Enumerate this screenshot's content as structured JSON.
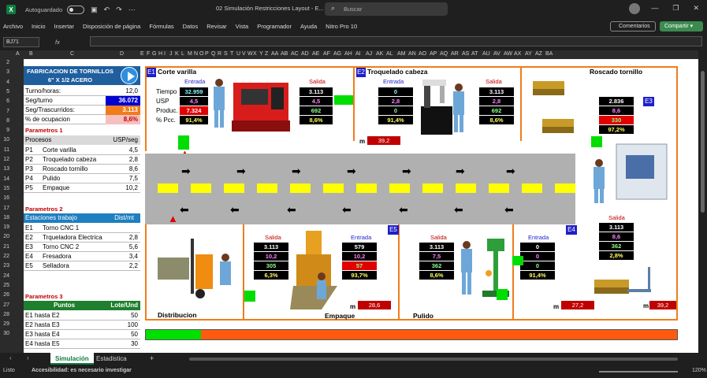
{
  "titlebar": {
    "autosave_label": "Autoguardado",
    "doc_title": "02 Simulación Restricciones Layout  -  E...",
    "search_placeholder": "Buscar"
  },
  "menu": [
    "Archivo",
    "Inicio",
    "Insertar",
    "Disposición de página",
    "Fórmulas",
    "Datos",
    "Revisar",
    "Vista",
    "Programador",
    "Ayuda",
    "Nitro Pro 10"
  ],
  "buttons": {
    "comments": "Comentarios",
    "share": "Compartir"
  },
  "formula": {
    "namebox": "BJ71",
    "fx": "fx"
  },
  "columns": [
    "A",
    "B",
    "C",
    "D",
    "E",
    "F",
    "G",
    "H",
    "I",
    "J",
    "K",
    "L",
    "M",
    "N",
    "O",
    "P",
    "Q",
    "R",
    "S",
    "T",
    "U",
    "V",
    "W",
    "X",
    "Y",
    "Z",
    "AA",
    "AB",
    "AC",
    "AD",
    "AE",
    "AF",
    "AG",
    "AH",
    "AI",
    "AJ",
    "AK",
    "AL",
    "AM",
    "AN",
    "AO",
    "AP",
    "AQ",
    "AR",
    "AS",
    "AT",
    "AU",
    "AV",
    "AW",
    "AX",
    "AY",
    "AZ",
    "BA"
  ],
  "rows": [
    "2",
    "3",
    "4",
    "5",
    "6",
    "7",
    "8",
    "9",
    "10",
    "11",
    "12",
    "13",
    "14",
    "15",
    "16",
    "17",
    "18",
    "19",
    "20",
    "21",
    "22",
    "23",
    "24",
    "25",
    "26",
    "27",
    "28",
    "29",
    "30"
  ],
  "left": {
    "header": "FABRICACION DE TORNILLOS 6\" X 1/2 ACERO",
    "turno_label": "Turno/horas:",
    "turno_value": "12,0",
    "seg_turno_label": "Seg/turno",
    "seg_turno_value": "36.072",
    "seg_tras_label": "Seg/Trascurridos:",
    "seg_tras_value": "3.113",
    "ocup_label": "% de ocupacion",
    "ocup_value": "8,6%",
    "p1_title": "Parametros 1",
    "p1_col1": "Procesos",
    "p1_col2": "USP/seg",
    "procesos": [
      {
        "code": "P1",
        "name": "Corte varilla",
        "value": "4,5"
      },
      {
        "code": "P2",
        "name": "Troquelado cabeza",
        "value": "2,8"
      },
      {
        "code": "P3",
        "name": "Roscado tornillo",
        "value": "8,6"
      },
      {
        "code": "P4",
        "name": "Pulido",
        "value": "7,5"
      },
      {
        "code": "P5",
        "name": "Empaque",
        "value": "10,2"
      }
    ],
    "p2_title": "Parametros 2",
    "p2_col1": "Estaciones trabajo",
    "p2_col2": "Dist/mt",
    "estaciones": [
      {
        "code": "E1",
        "name": "Torno CNC 1",
        "value": ""
      },
      {
        "code": "E2",
        "name": "Trqueladora Electrica",
        "value": "2,8"
      },
      {
        "code": "E3",
        "name": "Torno CNC 2",
        "value": "5,6"
      },
      {
        "code": "E4",
        "name": "Fresadora",
        "value": "3,4"
      },
      {
        "code": "E5",
        "name": "Selladora",
        "value": "2,2"
      }
    ],
    "p3_title": "Parametros 3",
    "p3_col1": "Puntos",
    "p3_col2": "Lote/Und",
    "puntos": [
      {
        "name": "E1 hasta E2",
        "value": "50"
      },
      {
        "name": "E2 hasta E3",
        "value": "100"
      },
      {
        "name": "E3 hasta E4",
        "value": "50"
      },
      {
        "name": "E4 hasta E5",
        "value": "30"
      }
    ]
  },
  "stations": {
    "e1": {
      "tag": "E1",
      "title": "Corte varilla",
      "entrada": "Entrada",
      "salida": "Salida",
      "row_labels": [
        "Tiempo",
        "USP",
        "Produc.",
        "% Pcc."
      ],
      "entrada_vals": [
        "32.959",
        "4,5",
        "7.324",
        "91,4%"
      ],
      "salida_vals": [
        "3.113",
        "4,5",
        "692",
        "8,6%"
      ]
    },
    "e2": {
      "tag": "E2",
      "title": "Troquelado cabeza",
      "entrada": "Entrada",
      "salida": "Salida",
      "entrada_vals": [
        "0",
        "2,8",
        "0",
        "91,4%"
      ],
      "salida_vals": [
        "3.113",
        "2,8",
        "692",
        "8,6%"
      ],
      "m_label": "m",
      "m_value": "39,2"
    },
    "e3": {
      "tag": "E3",
      "title": "Roscado tornillo",
      "salida": "Salida",
      "vals_top": [
        "2.836",
        "8,6",
        "330",
        "97,2%"
      ],
      "salida_vals": [
        "3.113",
        "8,6",
        "362",
        "2,8%"
      ],
      "m_label": "m",
      "m_value": "39,2"
    },
    "e4": {
      "tag": "E4",
      "title": "Pulido",
      "entrada": "Entrada",
      "salida": "Salida",
      "salida_vals": [
        "3.113",
        "7,5",
        "362",
        "8,6%"
      ],
      "entrada_vals": [
        "0",
        "0",
        "0",
        "91,4%"
      ],
      "m_label": "m",
      "m_value": "27,2"
    },
    "e5": {
      "tag": "E5",
      "title": "Empaque",
      "entrada": "Entrada",
      "salida": "Salida",
      "salida_vals": [
        "3.113",
        "10,2",
        "305",
        "6,3%"
      ],
      "entrada_vals": [
        "579",
        "10,2",
        "57",
        "93,7%"
      ],
      "m_label": "m",
      "m_value": "28,6"
    },
    "distribucion": {
      "title": "Distribucion"
    }
  },
  "progress": {
    "value_fraction": 0.104
  },
  "tabs": [
    "Simulación",
    "Estadistica"
  ],
  "status": {
    "ready": "Listo",
    "accessibility": "Accesibilidad: es necesario investigar",
    "zoom": "120%"
  }
}
